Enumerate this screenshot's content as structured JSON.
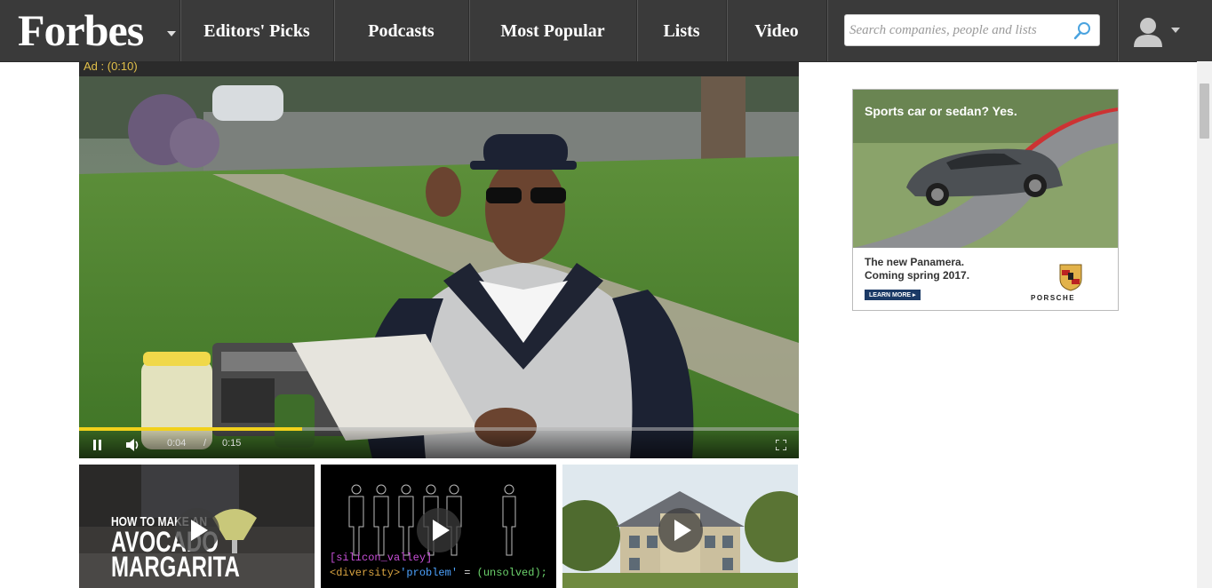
{
  "header": {
    "logo": "Forbes",
    "nav": [
      {
        "label": "Editors' Picks"
      },
      {
        "label": "Podcasts"
      },
      {
        "label": "Most Popular"
      },
      {
        "label": "Lists"
      },
      {
        "label": "Video"
      }
    ],
    "search": {
      "placeholder": "Search companies, people and lists",
      "value": ""
    }
  },
  "video": {
    "ad_label": "Ad : (0:10)",
    "current_time": "0:04",
    "separator": "/",
    "duration": "0:15",
    "progress_percent": 31
  },
  "thumbnails": [
    {
      "title_line1": "HOW TO MAKE AN",
      "title_line2": "AVOCADO",
      "title_line3": "MARGARITA"
    },
    {
      "code_line1": "[silicon_valley]",
      "code_tag": "<diversity>",
      "code_str": "'problem'",
      "code_eq": " = ",
      "code_val": "(unsolved);"
    },
    {}
  ],
  "ad": {
    "headline": "Sports car or sedan?  Yes.",
    "copy_line1": "The new Panamera.",
    "copy_line2": "Coming spring 2017.",
    "cta": "LEARN MORE ▸",
    "brand": "PORSCHE"
  },
  "colors": {
    "header_bg": "#3a3a3a",
    "progress": "#f2d11b",
    "ad_cta": "#1b3a66"
  }
}
